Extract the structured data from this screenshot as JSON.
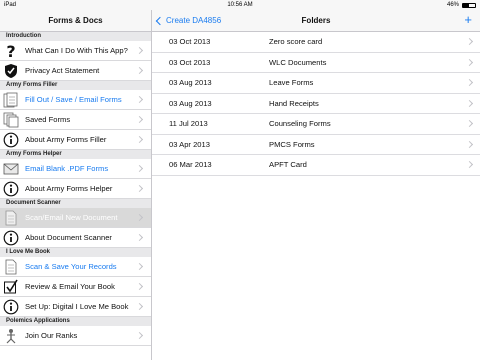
{
  "status_bar": {
    "device": "iPad",
    "time": "10:56 AM",
    "battery": "46%",
    "battery_level": 0.46
  },
  "sidebar": {
    "title": "Forms & Docs",
    "sections": [
      {
        "header": "Introduction",
        "items": [
          {
            "label": "What Can I Do With This App?",
            "icon": "question-mark-icon",
            "style": "normal"
          },
          {
            "label": "Privacy Act Statement",
            "icon": "shield-icon",
            "style": "normal"
          }
        ]
      },
      {
        "header": "Army Forms Filler",
        "items": [
          {
            "label": "Fill Out / Save / Email Forms",
            "icon": "forms-icon",
            "style": "blue"
          },
          {
            "label": "Saved Forms",
            "icon": "stacked-pages-icon",
            "style": "normal"
          },
          {
            "label": "About Army Forms Filler",
            "icon": "info-icon",
            "style": "normal"
          }
        ]
      },
      {
        "header": "Army Forms Helper",
        "items": [
          {
            "label": "Email Blank .PDF Forms",
            "icon": "envelope-icon",
            "style": "blue"
          },
          {
            "label": "About Army Forms Helper",
            "icon": "info-icon",
            "style": "normal"
          }
        ]
      },
      {
        "header": "Document Scanner",
        "items": [
          {
            "label": "Scan/Email New Document",
            "icon": "document-icon",
            "style": "selected"
          },
          {
            "label": "About Document Scanner",
            "icon": "info-icon",
            "style": "normal"
          }
        ]
      },
      {
        "header": "I Love Me Book",
        "items": [
          {
            "label": "Scan & Save Your Records",
            "icon": "document-icon",
            "style": "blue"
          },
          {
            "label": "Review & Email Your Book",
            "icon": "checkbox-icon",
            "style": "normal"
          },
          {
            "label": "Set Up: Digital I Love Me Book",
            "icon": "info-icon",
            "style": "normal"
          }
        ]
      },
      {
        "header": "Polemics Applications",
        "items": [
          {
            "label": "Join Our Ranks",
            "icon": "soldier-icon",
            "style": "normal"
          }
        ]
      }
    ]
  },
  "detail": {
    "back_label": "Create DA4856",
    "title": "Folders",
    "add_label": "+",
    "folders": [
      {
        "date": "03 Oct 2013",
        "name": "Zero score card"
      },
      {
        "date": "03 Oct 2013",
        "name": "WLC Documents"
      },
      {
        "date": "03 Aug 2013",
        "name": "Leave Forms"
      },
      {
        "date": "03 Aug 2013",
        "name": "Hand Receipts"
      },
      {
        "date": "11 Jul 2013",
        "name": "Counseling Forms"
      },
      {
        "date": "03 Apr 2013",
        "name": "PMCS Forms"
      },
      {
        "date": "06 Mar 2013",
        "name": "APFT Card"
      }
    ]
  },
  "colors": {
    "accent": "#1a7cf0",
    "separator": "#c8c7cc",
    "section_bg": "#e8e8ea",
    "selected_bg": "#d9d9d9"
  }
}
